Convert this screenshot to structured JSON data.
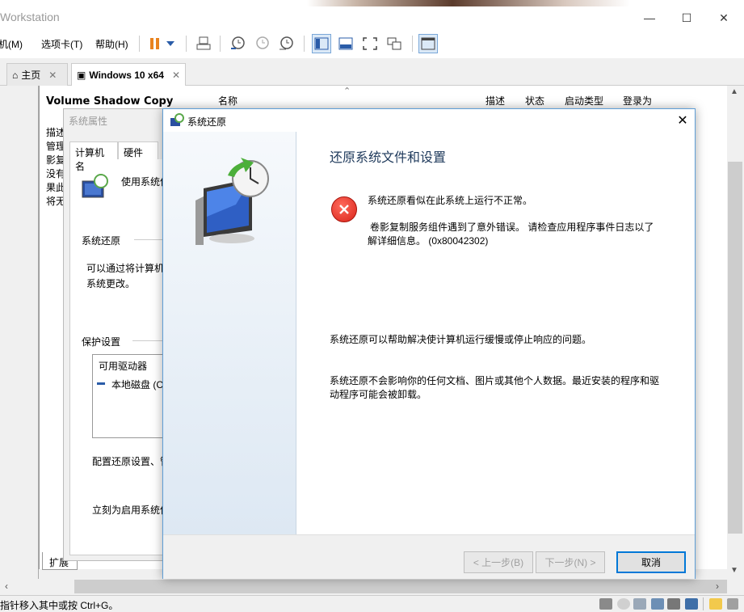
{
  "app": {
    "title": "Workstation",
    "window_controls": [
      "—",
      "☐",
      "✕"
    ]
  },
  "menu": {
    "items": [
      "机(M)",
      "选项卡(T)",
      "帮助(H)"
    ]
  },
  "tabs": [
    {
      "label": "主页",
      "close": "✕"
    },
    {
      "label": "Windows 10 x64",
      "close": "✕"
    }
  ],
  "services": {
    "title": "Volume Shadow Copy",
    "desc_lines": [
      "描述",
      "管理",
      "影复",
      "没有",
      "果此",
      "将无"
    ],
    "columns": {
      "name": "名称",
      "desc": "描述",
      "status": "状态",
      "startup": "启动类型",
      "logon": "登录为"
    },
    "ext_tab": "扩展"
  },
  "sysprops": {
    "title": "系统属性",
    "tabs": [
      "计算机名",
      "硬件"
    ],
    "use_text": "使用系统保护",
    "section_restore": "系统还原",
    "restore_desc_1": "可以通过将计算机",
    "restore_desc_2": "系统更改。",
    "section_protect": "保护设置",
    "list_header": "可用驱动器",
    "list_item": "本地磁盘 (C",
    "configure_text": "配置还原设置、管",
    "create_text": "立刻为启用系统保"
  },
  "dialog": {
    "title": "系统还原",
    "heading": "还原系统文件和设置",
    "error_title": "系统还原看似在此系统上运行不正常。",
    "error_detail_1": "卷影复制服务组件遇到了意外错误。 请检查应用程序事件日志以了",
    "error_detail_2": "解详细信息。 (0x80042302)",
    "info_1": "系统还原可以帮助解决使计算机运行缓慢或停止响应的问题。",
    "info_2_line1": "系统还原不会影响你的任何文档、图片或其他个人数据。最近安装的程序和驱",
    "info_2_line2": "动程序可能会被卸载。",
    "btn_back": "< 上一步(B)",
    "btn_next": "下一步(N) >",
    "btn_cancel": "取消",
    "close": "✕"
  },
  "status": {
    "text": "指针移入其中或按 Ctrl+G。"
  },
  "colors": {
    "dialog_border": "#5f9ed6",
    "heading": "#1e395b",
    "error_red": "#d9241a",
    "toolbar_orange": "#e8821e",
    "accent_blue": "#0078d7"
  }
}
